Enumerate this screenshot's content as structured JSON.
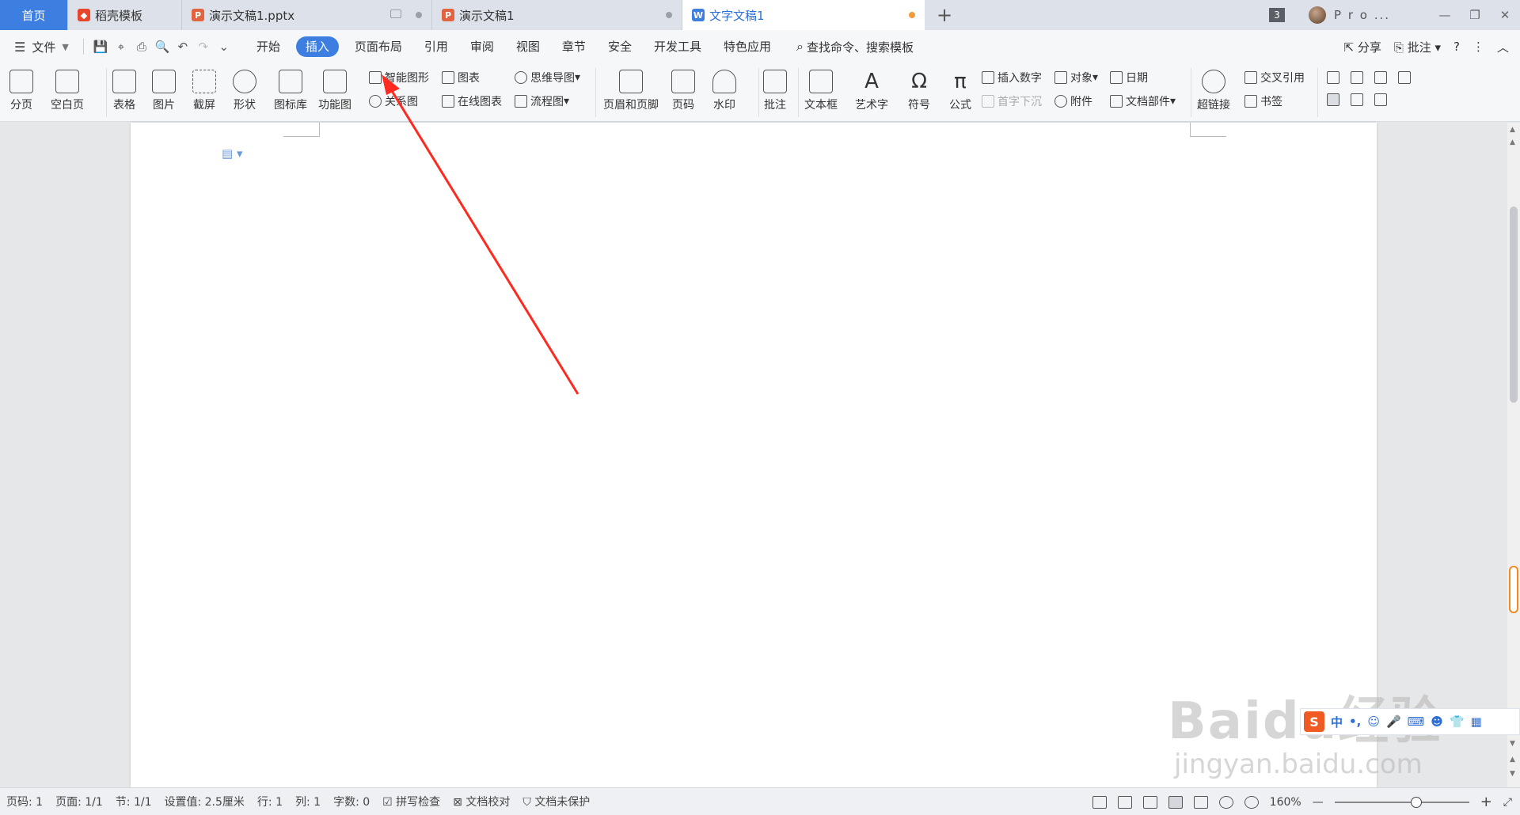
{
  "tabs": [
    {
      "label": "首页",
      "icon": "home"
    },
    {
      "label": "稻壳模板",
      "icon": "daoke-icon"
    },
    {
      "label": "演示文稿1.pptx",
      "icon": "ppt-icon"
    },
    {
      "label": "演示文稿1",
      "icon": "ppt-icon"
    },
    {
      "label": "文字文稿1",
      "icon": "word-icon",
      "active": true
    }
  ],
  "tabbar": {
    "window_count": "3",
    "user_name": "P r o ..."
  },
  "menu": {
    "file_label": "文件",
    "items": [
      "开始",
      "插入",
      "页面布局",
      "引用",
      "审阅",
      "视图",
      "章节",
      "安全",
      "开发工具",
      "特色应用"
    ],
    "active": "插入",
    "search_placeholder": "查找命令、搜索模板",
    "share_label": "分享",
    "comment_label": "批注"
  },
  "ribbon": {
    "large": [
      "分页",
      "空白页",
      "表格",
      "图片",
      "截屏",
      "形状",
      "图标库",
      "功能图",
      "页眉和页脚",
      "页码",
      "水印",
      "批注",
      "文本框",
      "艺术字",
      "符号",
      "公式",
      "超链接"
    ],
    "small": {
      "smart_shape": "智能图形",
      "chart": "图表",
      "mindmap": "思维导图",
      "relation": "关系图",
      "online_chart": "在线图表",
      "flowchart": "流程图",
      "insert_number": "插入数字",
      "object": "对象",
      "date": "日期",
      "drop_cap": "首字下沉",
      "attachment": "附件",
      "doc_parts": "文档部件",
      "cross_ref": "交叉引用",
      "bookmark": "书签"
    }
  },
  "ime": {
    "mode": "中"
  },
  "watermark": {
    "brand": "Baidu经验",
    "url": "jingyan.baidu.com"
  },
  "status": {
    "page": "页码: 1",
    "pages": "页面: 1/1",
    "section": "节: 1/1",
    "setting": "设置值: 2.5厘米",
    "row": "行: 1",
    "col": "列: 1",
    "words": "字数: 0",
    "spell": "拼写检查",
    "proof": "文档校对",
    "protect": "文档未保护",
    "zoom": "160%"
  },
  "colors": {
    "accent": "#3d7fe0",
    "arrow": "#ff2a1f",
    "tab_bg": "#dde2ea"
  }
}
